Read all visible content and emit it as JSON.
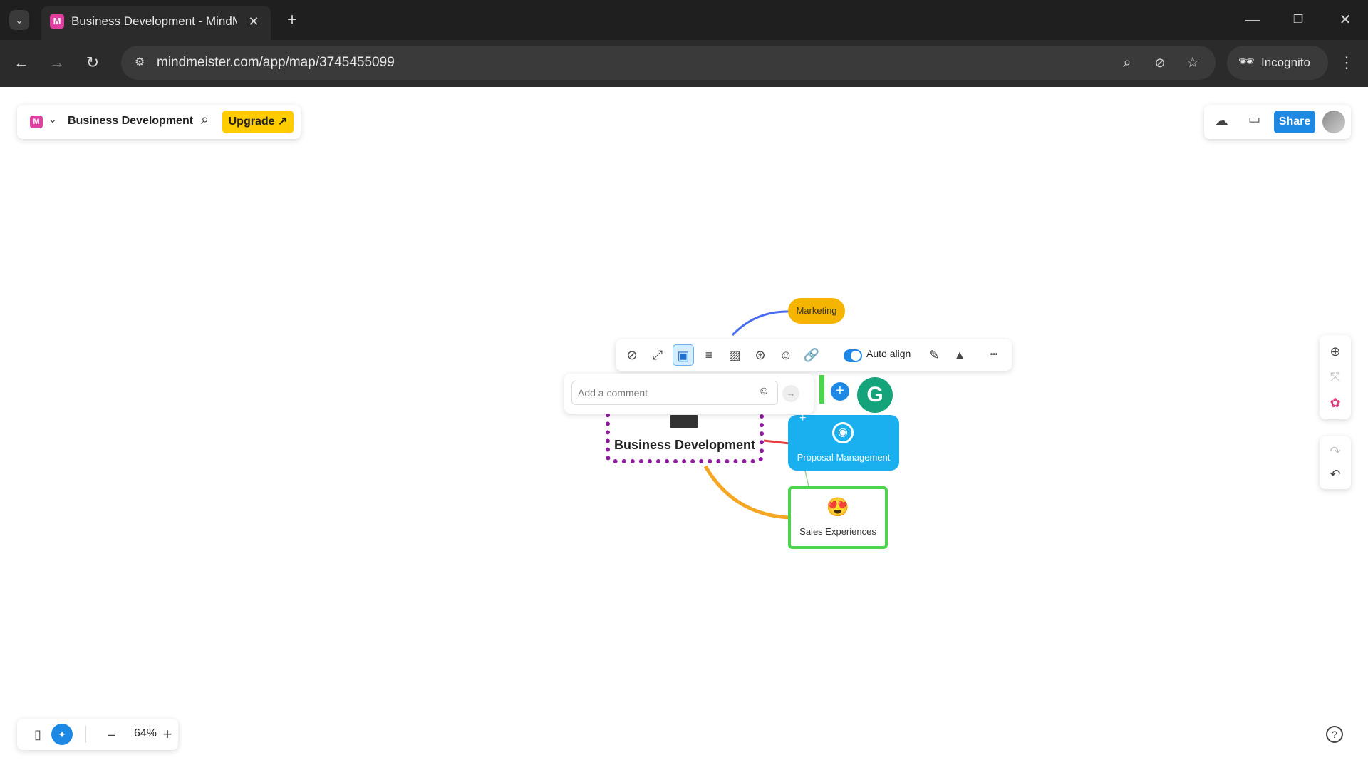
{
  "browser": {
    "tab_title": "Business Development - MindM",
    "favicon_letter": "M",
    "url": "mindmeister.com/app/map/3745455099",
    "incognito_label": "Incognito"
  },
  "topbar": {
    "map_title": "Business Development",
    "upgrade_label": "Upgrade ↗",
    "share_label": "Share"
  },
  "toolbar": {
    "auto_align_label": "Auto align",
    "auto_align_on": true,
    "more_label": "•••"
  },
  "comment": {
    "placeholder": "Add a comment"
  },
  "nodes": {
    "central": "Business Development",
    "marketing": "Marketing",
    "proposal": "Proposal Management",
    "sales": "Sales Experiences",
    "sales_emoji": "😍"
  },
  "grammarly_letter": "G",
  "zoom": {
    "level": "64%",
    "minus": "–",
    "plus": "+"
  },
  "colors": {
    "brand": "#e040a0",
    "share": "#1e88e5",
    "upgrade": "#ffcc00",
    "central_border": "#8e1a9e",
    "marketing": "#f4b400",
    "proposal": "#1ab0f0",
    "sales_border": "#4cd44c",
    "grammarly": "#15a37b"
  }
}
